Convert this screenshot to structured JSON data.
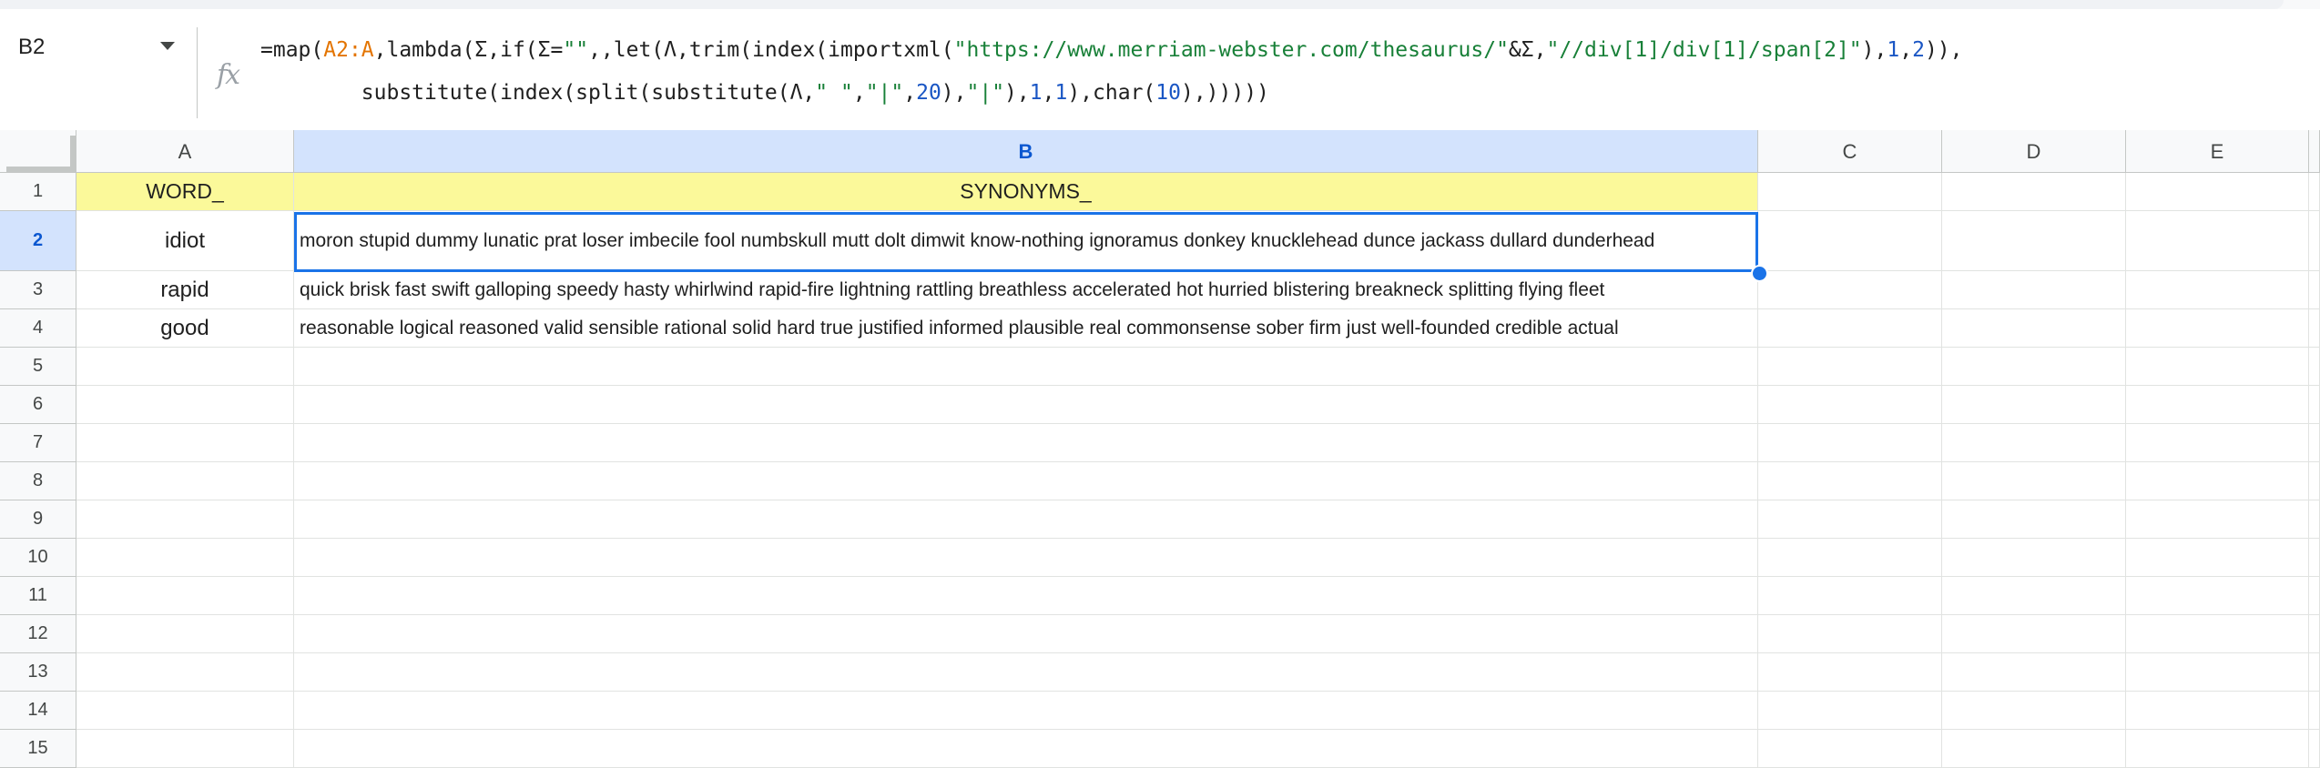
{
  "name_box": {
    "value": "B2"
  },
  "formula": {
    "line1": [
      {
        "t": "=map(",
        "c": "plain"
      },
      {
        "t": "A2:A",
        "c": "ref"
      },
      {
        "t": ",lambda(Σ,if(Σ=",
        "c": "plain"
      },
      {
        "t": "\"\"",
        "c": "str"
      },
      {
        "t": ",,let(Λ,trim(index(importxml(",
        "c": "plain"
      },
      {
        "t": "\"https://www.merriam-webster.com/thesaurus/\"",
        "c": "str"
      },
      {
        "t": "&Σ,",
        "c": "plain"
      },
      {
        "t": "\"//div[1]/div[1]/span[2]\"",
        "c": "str"
      },
      {
        "t": "),",
        "c": "plain"
      },
      {
        "t": "1",
        "c": "num"
      },
      {
        "t": ",",
        "c": "plain"
      },
      {
        "t": "2",
        "c": "num"
      },
      {
        "t": ")),",
        "c": "plain"
      }
    ],
    "line2": [
      {
        "t": "        substitute(index(split(substitute(Λ,",
        "c": "plain"
      },
      {
        "t": "\" \"",
        "c": "str"
      },
      {
        "t": ",",
        "c": "plain"
      },
      {
        "t": "\"|\"",
        "c": "str"
      },
      {
        "t": ",",
        "c": "plain"
      },
      {
        "t": "20",
        "c": "num"
      },
      {
        "t": "),",
        "c": "plain"
      },
      {
        "t": "\"|\"",
        "c": "str"
      },
      {
        "t": "),",
        "c": "plain"
      },
      {
        "t": "1",
        "c": "num"
      },
      {
        "t": ",",
        "c": "plain"
      },
      {
        "t": "1",
        "c": "num"
      },
      {
        "t": "),char(",
        "c": "plain"
      },
      {
        "t": "10",
        "c": "num"
      },
      {
        "t": "),)))))",
        "c": "plain"
      }
    ]
  },
  "columns": [
    "A",
    "B",
    "C",
    "D",
    "E"
  ],
  "selected_column": "B",
  "rows": [
    {
      "num": "1",
      "a": "WORD_",
      "b": "SYNONYMS_"
    },
    {
      "num": "2",
      "a": "idiot",
      "b": "moron stupid dummy lunatic prat loser imbecile fool numbskull mutt dolt dimwit know-nothing ignoramus donkey knucklehead dunce jackass dullard dunderhead"
    },
    {
      "num": "3",
      "a": "rapid",
      "b": "quick brisk fast swift galloping speedy hasty whirlwind rapid-fire lightning rattling breathless accelerated hot hurried blistering breakneck splitting flying fleet"
    },
    {
      "num": "4",
      "a": "good",
      "b": "reasonable logical reasoned valid sensible rational solid hard true justified informed plausible real commonsense sober firm just well-founded credible actual"
    },
    {
      "num": "5",
      "a": "",
      "b": ""
    },
    {
      "num": "6",
      "a": "",
      "b": ""
    },
    {
      "num": "7",
      "a": "",
      "b": ""
    },
    {
      "num": "8",
      "a": "",
      "b": ""
    },
    {
      "num": "9",
      "a": "",
      "b": ""
    },
    {
      "num": "10",
      "a": "",
      "b": ""
    },
    {
      "num": "11",
      "a": "",
      "b": ""
    },
    {
      "num": "12",
      "a": "",
      "b": ""
    },
    {
      "num": "13",
      "a": "",
      "b": ""
    },
    {
      "num": "14",
      "a": "",
      "b": ""
    },
    {
      "num": "15",
      "a": "",
      "b": ""
    }
  ],
  "selected_row": "2",
  "colors": {
    "header_fill": "#fbf99a",
    "selection": "#1a73e8",
    "selected_header": "#d3e3fd"
  }
}
